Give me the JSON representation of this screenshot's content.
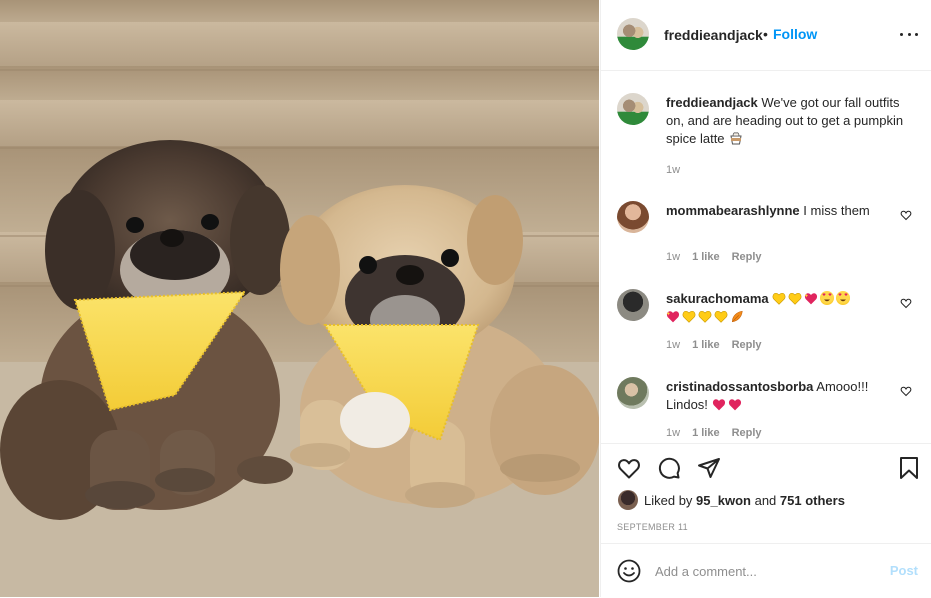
{
  "post": {
    "username": "freddieandjack",
    "follow_label": "Follow",
    "separator": "•"
  },
  "caption": {
    "username": "freddieandjack",
    "text": "We've got our fall outfits on, and are heading out to get a pumpkin spice latte",
    "time": "1w"
  },
  "comments": [
    {
      "username": "mommabearashlynne",
      "text": "I miss them",
      "time": "1w",
      "likes": "1 like",
      "reply": "Reply"
    },
    {
      "username": "sakurachomama",
      "text": "",
      "time": "1w",
      "likes": "1 like",
      "reply": "Reply"
    },
    {
      "username": "cristinadossantosborba",
      "text": "Amooo!!! Lindos!",
      "time": "1w",
      "likes": "1 like",
      "reply": "Reply"
    }
  ],
  "likes": {
    "prefix": "Liked by",
    "user": "95_kwon",
    "conjunction": "and",
    "others": "751 others"
  },
  "date": "SEPTEMBER 11",
  "add_comment": {
    "placeholder": "Add a comment...",
    "post_label": "Post"
  },
  "colors": {
    "accent": "#0095f6",
    "post_disabled": "#b2dffc",
    "meta": "#8e8e8e"
  },
  "icons": [
    "more-icon",
    "heart-icon",
    "comment-icon",
    "share-icon",
    "bookmark-icon",
    "emoji-icon"
  ]
}
